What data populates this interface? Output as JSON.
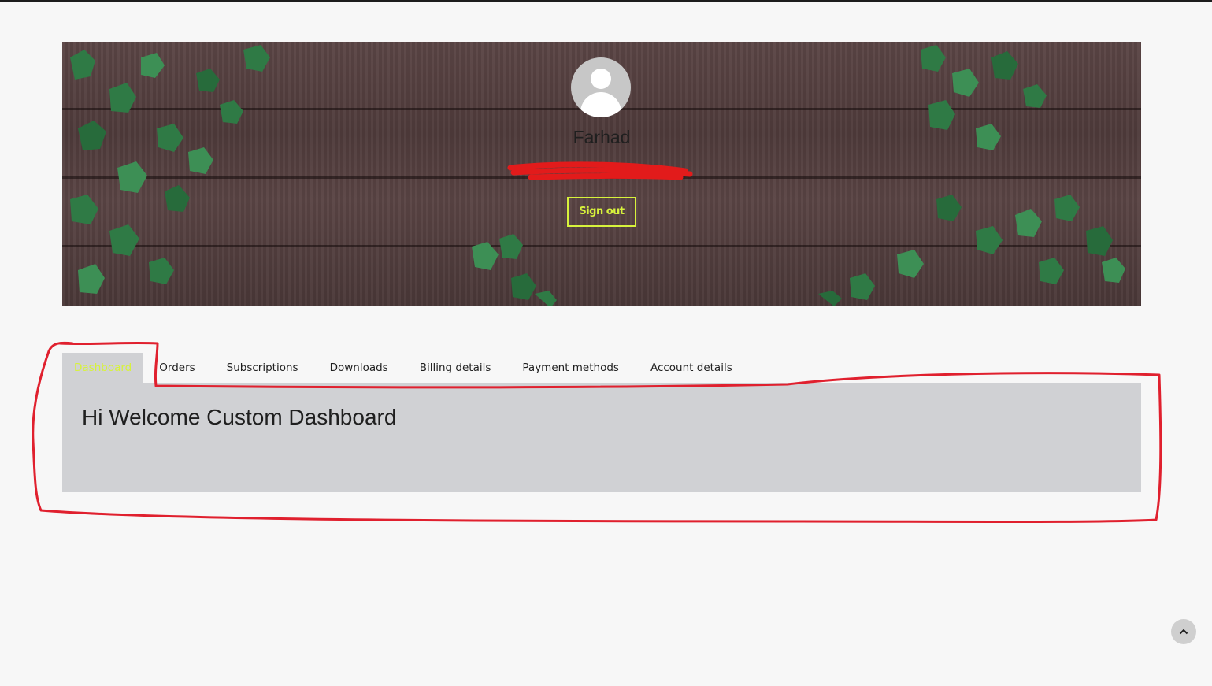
{
  "profile": {
    "name": "Farhad",
    "sign_out_label": "Sign out"
  },
  "tabs": [
    {
      "label": "Dashboard",
      "active": true
    },
    {
      "label": "Orders",
      "active": false
    },
    {
      "label": "Subscriptions",
      "active": false
    },
    {
      "label": "Downloads",
      "active": false
    },
    {
      "label": "Billing details",
      "active": false
    },
    {
      "label": "Payment methods",
      "active": false
    },
    {
      "label": "Account details",
      "active": false
    }
  ],
  "dashboard": {
    "heading": "Hi Welcome Custom Dashboard"
  },
  "icons": {
    "avatar": "user-avatar-icon",
    "scroll_top": "chevron-up-icon"
  },
  "colors": {
    "accent": "#d7f23c",
    "annotation": "#e0202e",
    "panel": "#d0d1d4"
  }
}
